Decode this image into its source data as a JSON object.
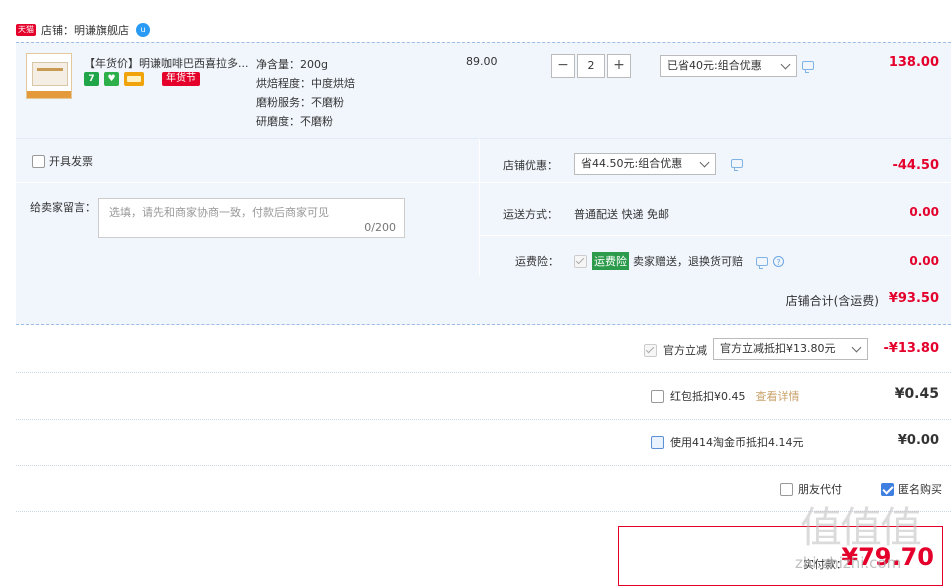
{
  "shop": {
    "tmall_label": "天猫",
    "name_label": "店铺：明谦旗舰店",
    "chat_icon": "wangwang-chat-icon",
    "chat_badge": "u"
  },
  "item": {
    "title": "【年货价】明谦咖啡巴西喜拉多...",
    "tags": [
      {
        "label": "7",
        "color": "#20a548",
        "icon": "seven-day-return-icon"
      },
      {
        "label": "♥",
        "color": "#2db04a",
        "icon": "guarantee-icon"
      },
      {
        "label": "",
        "color": "#f0a30a",
        "icon": "credit-card-icon"
      }
    ],
    "festival_tag": "年货节",
    "attributes": [
      "净含量：200g",
      "烘焙程度：中度烘焙",
      "磨粉服务：不磨粉",
      "研磨度：不磨粉"
    ],
    "unit_price": "89.00",
    "quantity": "2",
    "qty_minus": "−",
    "qty_plus": "+",
    "promo_select": "已省40元:组合优惠",
    "subtotal": "138.00"
  },
  "invoice": {
    "label": "开具发票"
  },
  "memo": {
    "label": "给卖家留言：",
    "placeholder": "选填，请先和商家协商一致，付款后商家可见",
    "counter": "0/200"
  },
  "shop_discount": {
    "label": "店铺优惠：",
    "select": "省44.50元:组合优惠",
    "amount": "-44.50"
  },
  "shipping": {
    "label": "运送方式：",
    "method": "普通配送 快递 免邮",
    "amount": "0.00"
  },
  "insurance": {
    "label": "运费险：",
    "badge": "运费险",
    "desc": "卖家赠送，退换货可赔",
    "amount": "0.00"
  },
  "shop_total": {
    "label": "店铺合计(含运费)",
    "amount": "¥93.50"
  },
  "official_discount": {
    "label": "官方立减",
    "select": "官方立减抵扣¥13.80元",
    "amount": "-¥13.80"
  },
  "red_packet": {
    "label": "红包抵扣¥0.45",
    "link": "查看详情",
    "amount": "¥0.45"
  },
  "coins": {
    "label": "使用414淘金币抵扣4.14元",
    "amount": "¥0.00"
  },
  "options": {
    "friend_pay": "朋友代付",
    "anonymous": "匿名购买"
  },
  "payment": {
    "label": "实付款：",
    "amount": "¥79.70"
  },
  "watermark": "值值值",
  "watermark_url": "zhi.zhizhi.com",
  "colors": {
    "accent_red": "#e4002b",
    "panel_blue": "#f1f6fd",
    "check_blue": "#3e7fe0"
  }
}
